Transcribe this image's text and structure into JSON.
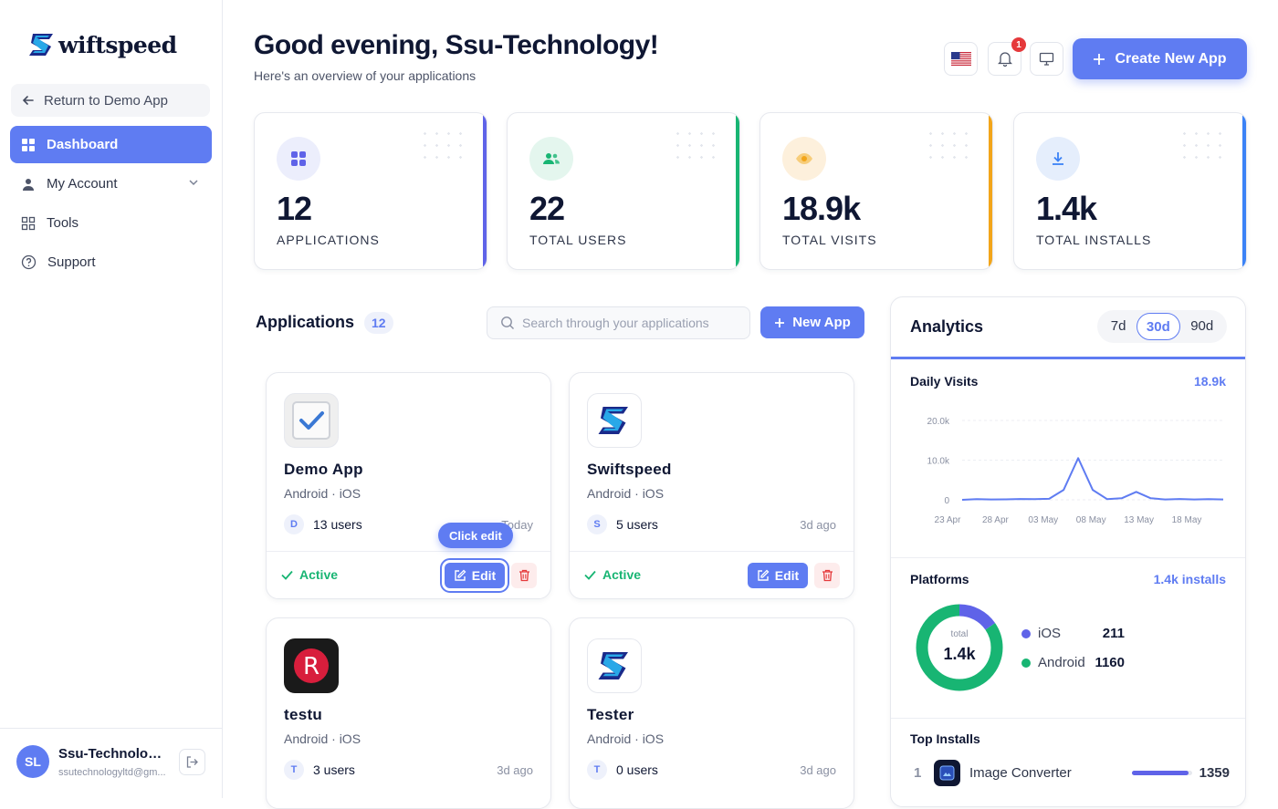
{
  "brand": {
    "name": "wiftspeed"
  },
  "sidebar": {
    "return_label": "Return to Demo App",
    "items": [
      {
        "label": "Dashboard"
      },
      {
        "label": "My Account"
      },
      {
        "label": "Tools"
      },
      {
        "label": "Support"
      }
    ],
    "user": {
      "initials": "SL",
      "name": "Ssu-Technology...",
      "email": "ssutechnologyltd@gm..."
    }
  },
  "header": {
    "greeting": "Good evening, Ssu-Technology!",
    "subtitle": "Here's an overview of your applications",
    "notification_count": "1",
    "create_label": "Create New App"
  },
  "stats": [
    {
      "value": "12",
      "label": "APPLICATIONS",
      "color": "#5f63e8",
      "icon": "grid-icon"
    },
    {
      "value": "22",
      "label": "TOTAL USERS",
      "color": "#18b573",
      "icon": "users-icon"
    },
    {
      "value": "18.9k",
      "label": "TOTAL VISITS",
      "color": "#f2a51a",
      "icon": "eye-icon"
    },
    {
      "value": "1.4k",
      "label": "TOTAL INSTALLS",
      "color": "#3b82f6",
      "icon": "download-icon"
    }
  ],
  "applications": {
    "title": "Applications",
    "count": "12",
    "search_placeholder": "Search through your applications",
    "new_label": "New App",
    "tooltip": "Click edit",
    "cards": [
      {
        "name": "Demo App",
        "platforms": "Android · iOS",
        "initial": "D",
        "users": "13 users",
        "time": "Today",
        "status": "Active",
        "edit": "Edit",
        "icon": "checkmark-icon"
      },
      {
        "name": "Swiftspeed",
        "platforms": "Android · iOS",
        "initial": "S",
        "users": "5 users",
        "time": "3d ago",
        "status": "Active",
        "edit": "Edit",
        "icon": "swiftspeed-logo-icon"
      },
      {
        "name": "testu",
        "platforms": "Android · iOS",
        "initial": "T",
        "users": "3 users",
        "time": "3d ago",
        "icon": "letter-r-icon"
      },
      {
        "name": "Tester",
        "platforms": "Android · iOS",
        "initial": "T",
        "users": "0 users",
        "time": "3d ago",
        "icon": "swiftspeed-logo-icon"
      }
    ]
  },
  "analytics": {
    "title": "Analytics",
    "ranges": [
      "7d",
      "30d",
      "90d"
    ],
    "selected_range": "30d",
    "daily_visits": {
      "label": "Daily Visits",
      "total": "18.9k"
    },
    "platforms": {
      "label": "Platforms",
      "total_label": "1.4k installs",
      "center_small": "total",
      "center_value": "1.4k",
      "items": [
        {
          "name": "iOS",
          "value": "211",
          "color": "#5f63e8"
        },
        {
          "name": "Android",
          "value": "1160",
          "color": "#18b573"
        }
      ]
    },
    "top_installs": {
      "label": "Top Installs",
      "items": [
        {
          "rank": "1",
          "name": "Image Converter",
          "value": "1359",
          "fraction": 0.95
        }
      ]
    }
  },
  "chart_data": {
    "type": "line",
    "title": "Daily Visits",
    "x_ticks": [
      "23 Apr",
      "28 Apr",
      "03 May",
      "08 May",
      "13 May",
      "18 May"
    ],
    "y_ticks": [
      "20.0k",
      "10.0k",
      "0"
    ],
    "ylim": [
      0,
      20000
    ],
    "x": [
      "23 Apr",
      "25 Apr",
      "27 Apr",
      "29 Apr",
      "01 May",
      "03 May",
      "05 May",
      "06 May",
      "07 May",
      "08 May",
      "09 May",
      "10 May",
      "11 May",
      "12 May",
      "13 May",
      "15 May",
      "17 May",
      "19 May",
      "21 May"
    ],
    "values": [
      0,
      150,
      100,
      120,
      200,
      150,
      250,
      2500,
      10500,
      2500,
      150,
      400,
      2000,
      400,
      100,
      200,
      100,
      150,
      100
    ],
    "grid": true,
    "color": "#5f7cf2"
  }
}
